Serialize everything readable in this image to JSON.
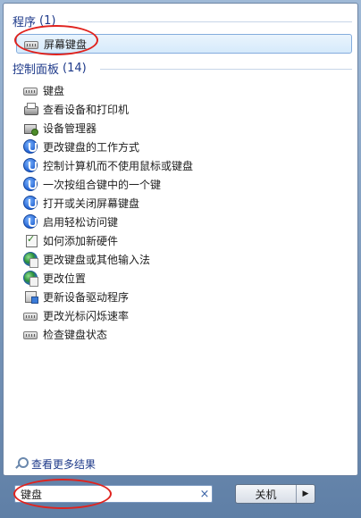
{
  "programs": {
    "header": "程序",
    "count": "(1)",
    "items": [
      {
        "label": "屏幕键盘",
        "icon": "keyboard-icon"
      }
    ]
  },
  "control_panel": {
    "header": "控制面板",
    "count": "(14)",
    "items": [
      {
        "label": "键盘",
        "icon": "keyboard-icon"
      },
      {
        "label": "查看设备和打印机",
        "icon": "printer-icon"
      },
      {
        "label": "设备管理器",
        "icon": "device-manager-icon"
      },
      {
        "label": "更改键盘的工作方式",
        "icon": "ease-of-access-icon"
      },
      {
        "label": "控制计算机而不使用鼠标或键盘",
        "icon": "ease-of-access-icon"
      },
      {
        "label": "一次按组合键中的一个键",
        "icon": "ease-of-access-icon"
      },
      {
        "label": "打开或关闭屏幕键盘",
        "icon": "ease-of-access-icon"
      },
      {
        "label": "启用轻松访问键",
        "icon": "ease-of-access-icon"
      },
      {
        "label": "如何添加新硬件",
        "icon": "hardware-wizard-icon"
      },
      {
        "label": "更改键盘或其他输入法",
        "icon": "globe-icon"
      },
      {
        "label": "更改位置",
        "icon": "globe-icon"
      },
      {
        "label": "更新设备驱动程序",
        "icon": "driver-icon"
      },
      {
        "label": "更改光标闪烁速率",
        "icon": "keyboard-icon"
      },
      {
        "label": "检查键盘状态",
        "icon": "keyboard-icon"
      }
    ]
  },
  "more_results": {
    "label": "查看更多结果",
    "icon": "search-icon"
  },
  "search": {
    "value": "键盘",
    "clear_symbol": "×"
  },
  "shutdown": {
    "label": "关机",
    "arrow": "▶"
  },
  "colors": {
    "header": "#1e3a8a",
    "annotation": "#e0231e",
    "selected": "#d6eafb"
  }
}
